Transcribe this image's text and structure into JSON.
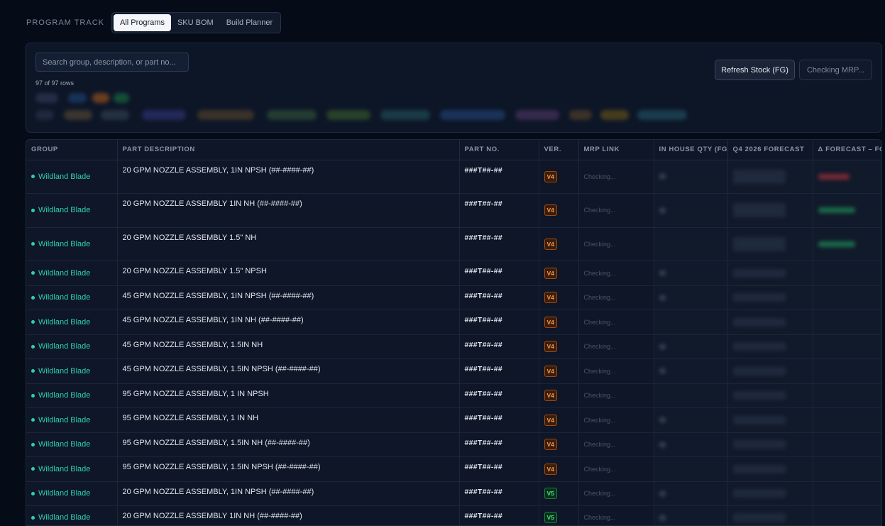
{
  "program_track": {
    "label": "PROGRAM TRACK",
    "tabs": [
      {
        "label": "All Programs",
        "active": true
      },
      {
        "label": "SKU BOM",
        "active": false
      },
      {
        "label": "Build Planner",
        "active": false
      }
    ]
  },
  "filters": {
    "search_placeholder": "Search group, description, or part no...",
    "row_count": "97 of 97 rows",
    "refresh_label": "Refresh Stock (FG)",
    "mrp_label": "Checking MRP..."
  },
  "table": {
    "columns": [
      "GROUP",
      "PART DESCRIPTION",
      "PART NO.",
      "VER.",
      "MRP LINK",
      "IN HOUSE QTY (FG)",
      "Q4 2026 FORECAST",
      "Δ FORECAST – FG"
    ],
    "mrp_status": "Checking...",
    "rows": [
      {
        "group": "Wildland Blade",
        "description": "20 GPM NOZZLE ASSEMBLY, 1IN NPSH (##-####-##)",
        "part_no": "###T##-##",
        "ver": "V4"
      },
      {
        "group": "Wildland Blade",
        "description": "20 GPM NOZZLE ASSEMBLY 1IN NH (##-####-##)",
        "part_no": "###T##-##",
        "ver": "V4"
      },
      {
        "group": "Wildland Blade",
        "description": "20 GPM NOZZLE ASSEMBLY 1.5\" NH",
        "part_no": "###T##-##",
        "ver": "V4"
      },
      {
        "group": "Wildland Blade",
        "description": "20 GPM NOZZLE ASSEMBLY 1.5\" NPSH",
        "part_no": "###T##-##",
        "ver": "V4"
      },
      {
        "group": "Wildland Blade",
        "description": "45 GPM NOZZLE ASSEMBLY, 1IN NPSH (##-####-##)",
        "part_no": "###T##-##",
        "ver": "V4"
      },
      {
        "group": "Wildland Blade",
        "description": "45 GPM NOZZLE ASSEMBLY, 1IN NH (##-####-##)",
        "part_no": "###T##-##",
        "ver": "V4"
      },
      {
        "group": "Wildland Blade",
        "description": "45 GPM NOZZLE ASSEMBLY, 1.5IN NH",
        "part_no": "###T##-##",
        "ver": "V4"
      },
      {
        "group": "Wildland Blade",
        "description": "45 GPM NOZZLE ASSEMBLY, 1.5IN NPSH (##-####-##)",
        "part_no": "###T##-##",
        "ver": "V4"
      },
      {
        "group": "Wildland Blade",
        "description": "95 GPM NOZZLE ASSEMBLY, 1 IN NPSH",
        "part_no": "###T##-##",
        "ver": "V4"
      },
      {
        "group": "Wildland Blade",
        "description": "95 GPM NOZZLE ASSEMBLY, 1 IN NH",
        "part_no": "###T##-##",
        "ver": "V4"
      },
      {
        "group": "Wildland Blade",
        "description": "95 GPM NOZZLE ASSEMBLY, 1.5IN NH (##-####-##)",
        "part_no": "###T##-##",
        "ver": "V4"
      },
      {
        "group": "Wildland Blade",
        "description": "95 GPM NOZZLE ASSEMBLY, 1.5IN NPSH (##-####-##)",
        "part_no": "###T##-##",
        "ver": "V4"
      },
      {
        "group": "Wildland Blade",
        "description": "20 GPM NOZZLE ASSEMBLY, 1IN NPSH (##-####-##)",
        "part_no": "###T##-##",
        "ver": "V5"
      },
      {
        "group": "Wildland Blade",
        "description": "20 GPM NOZZLE ASSEMBLY 1IN NH (##-####-##)",
        "part_no": "###T##-##",
        "ver": "V5"
      }
    ]
  }
}
